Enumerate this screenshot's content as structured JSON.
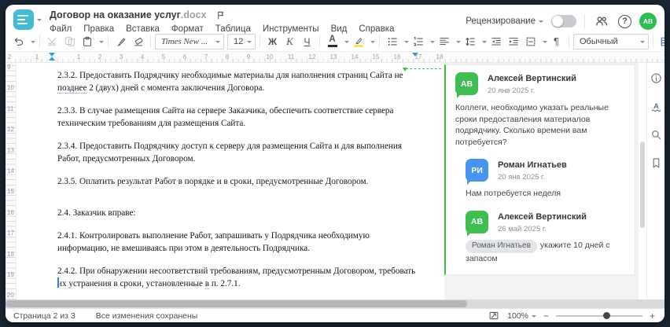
{
  "header": {
    "title": "Договор на оказание услуг",
    "title_ext": ".docx",
    "menu": [
      "Файл",
      "Правка",
      "Вставка",
      "Формат",
      "Таблица",
      "Инструменты",
      "Вид",
      "Справка"
    ],
    "review_label": "Рецензирование",
    "help_label": "?",
    "avatar_initials": "АВ"
  },
  "toolbar": {
    "font_name": "Times New ...",
    "font_size": "12",
    "bold_label": "Ж",
    "italic_label": "К",
    "underline_label": "Ч",
    "font_color_label": "А",
    "pilcrow_label": "¶",
    "style_name": "Обычный",
    "more_label": "..."
  },
  "ruler": {
    "h_pre": [
      "2",
      "1"
    ],
    "h_main": [
      "1",
      "2",
      "3",
      "4",
      "5",
      "6",
      "7",
      "8",
      "9",
      "10",
      "11",
      "12",
      "13",
      "14",
      "15",
      "16",
      "17",
      "18"
    ],
    "v": [
      "9",
      "10",
      "11",
      "12",
      "13",
      "14",
      "15",
      "16",
      "17",
      "18",
      "19",
      "20"
    ]
  },
  "document": {
    "paragraphs": [
      {
        "segments": [
          {
            "t": "2.3.2. Предоставить Подрядчику необходимые материалы для наполнения страниц Сайта не",
            "br": true
          },
          {
            "t": "позднее",
            "u": true
          },
          {
            "t": " 2 (двух) дней с момента заключения Договора."
          }
        ]
      },
      {
        "segments": [
          {
            "t": "2.3.3. В случае размещения Сайта на сервере Заказчика, обеспечить соответствие сервера",
            "br": true
          },
          {
            "t": "техническим требованиям для размещения Сайта."
          }
        ]
      },
      {
        "segments": [
          {
            "t": "2.3.4. Предоставить Подрядчику доступ к серверу для размещения Сайта и для выполнения",
            "br": true
          },
          {
            "t": "Работ, предусмотренных Договором."
          }
        ]
      },
      {
        "segments": [
          {
            "t": "2.3.5. Оплатить результат Работ в порядке и в сроки, предусмотренные Договором."
          }
        ]
      },
      {
        "gap": true,
        "segments": [
          {
            "t": "2.4. Заказчик вправе:"
          }
        ]
      },
      {
        "segments": [
          {
            "t": "2.4.1. Контролировать выполнение Работ, запрашивать у Подрядчика необходимую",
            "br": true
          },
          {
            "t": "информацию, не вмешиваясь при этом в деятельность Подрядчика."
          }
        ]
      },
      {
        "segments": [
          {
            "t": "2.4.2. При обнаружении несоответствий требованиям, предусмотренным Договором, требовать",
            "br": true
          },
          {
            "t": "их устранения в сроки, установленные "
          },
          {
            "t": "в",
            "u": true
          },
          {
            "t": " п. 2.7.1."
          }
        ]
      }
    ]
  },
  "comments": {
    "thread": [
      {
        "initials": "АВ",
        "color": "#3dbe4e",
        "name": "Алексей Вертинский",
        "date": "20 янв 2025 г.",
        "text": "Коллеги, необходимо указать реальные сроки предоставления материалов подрядчику. Сколько времени вам потребуется?",
        "reply": false
      },
      {
        "initials": "РИ",
        "color": "#4594f0",
        "name": "Роман Игнатьев",
        "date": "20 янв 2025 г.",
        "text": "Нам потребуется неделя",
        "reply": true
      },
      {
        "initials": "АВ",
        "color": "#3dbe4e",
        "name": "Алексей Вертинский",
        "date": "26 май 2025 г.",
        "mention": "Роман Игнатьев",
        "text": "укажите 10 дней с запасом",
        "reply": true
      }
    ]
  },
  "statusbar": {
    "page_label": "Страница 2 из 3",
    "saved_label": "Все изменения сохранены",
    "zoom_value": "100%",
    "minus_label": "−",
    "plus_label": "+"
  },
  "colors": {
    "accent_teal": "#41bcd6",
    "accent_green": "#3dbe4e",
    "avatar_green": "#2abf4e",
    "avatar_blue": "#4594f0",
    "highlight_yellow": "#fce14e",
    "font_color_black": "#2b2b2b"
  }
}
